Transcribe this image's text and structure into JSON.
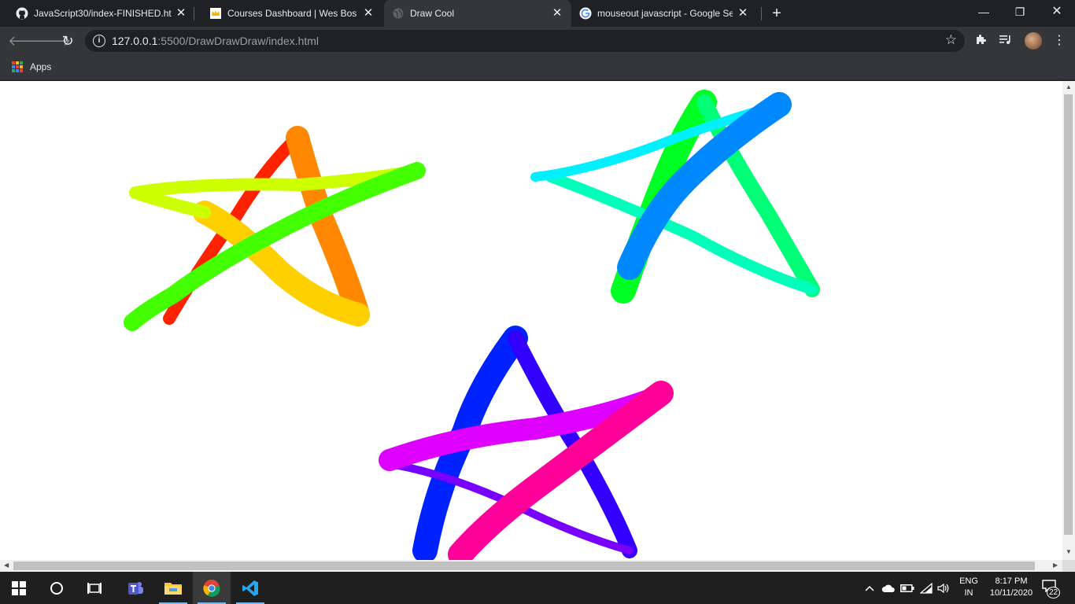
{
  "browser": {
    "tabs": [
      {
        "title": "JavaScript30/index-FINISHED.htm",
        "icon": "github-icon"
      },
      {
        "title": "Courses Dashboard | Wes Bos",
        "icon": "crown-icon"
      },
      {
        "title": "Draw Cool",
        "icon": "globe-icon",
        "active": true
      },
      {
        "title": "mouseout javascript - Google Se",
        "icon": "google-icon"
      }
    ],
    "address": {
      "host": "127.0.0.1",
      "rest": ":5500/DrawDrawDraw/index.html"
    },
    "bookmarks": {
      "apps_label": "Apps"
    }
  },
  "canvas": {
    "background": "#ffffff",
    "description_colors": [
      "#ff0000",
      "#ff8000",
      "#ffff00",
      "#80ff00",
      "#00ff00",
      "#00ffff",
      "#0080ff",
      "#0000ff",
      "#8000ff",
      "#ff00ff",
      "#ff0080"
    ]
  },
  "taskbar": {
    "apps": [
      "start-icon",
      "search-icon",
      "task-view-icon",
      "teams-icon",
      "file-explorer-icon",
      "chrome-icon",
      "vscode-icon"
    ],
    "language": {
      "line1": "ENG",
      "line2": "IN"
    },
    "clock": {
      "time": "8:17 PM",
      "date": "10/11/2020"
    },
    "notifications": "22"
  }
}
